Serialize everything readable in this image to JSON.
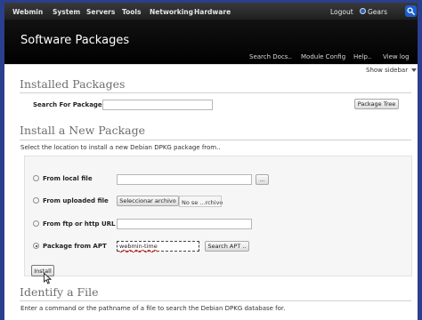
{
  "topnav": {
    "items": [
      "Webmin",
      "System",
      "Servers",
      "Tools",
      "Networking",
      "Hardware"
    ],
    "logout": "Logout",
    "gears": "Gears"
  },
  "header": {
    "title": "Software Packages",
    "links": [
      "Search Docs..",
      "Module Config",
      "Help..",
      "View log"
    ],
    "show_sidebar": "Show sidebar"
  },
  "installed": {
    "title": "Installed Packages",
    "search_label": "Search For Package:",
    "search_value": "",
    "tree_button": "Package Tree"
  },
  "install": {
    "title": "Install a New Package",
    "description": "Select the location to install a new Debian DPKG package from..",
    "options": [
      {
        "label": "From local file",
        "checked": false
      },
      {
        "label": "From uploaded file",
        "checked": false
      },
      {
        "label": "From ftp or http URL",
        "checked": false
      },
      {
        "label": "Package from APT",
        "checked": true
      }
    ],
    "browse_button": "...",
    "choose_file_button": "Seleccionar archivo",
    "no_file_text": "No se ...rchivo",
    "apt_value": "webmin-time",
    "search_apt_button": "Search APT ..",
    "install_button": "Install"
  },
  "identify": {
    "title": "Identify a File",
    "description": "Enter a command or the pathname of a file to search the Debian DPKG database for."
  },
  "colors": {
    "frame_bg": "#2a3f8f",
    "topnav_bg": "#2b2b2b",
    "header_bg": "#000000",
    "accent_blue": "#1c5fd1"
  }
}
